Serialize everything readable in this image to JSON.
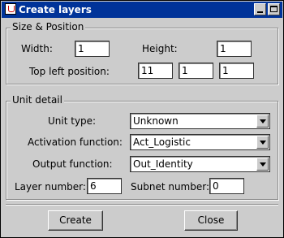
{
  "window": {
    "title": "Create layers"
  },
  "size_position": {
    "legend": "Size & Position",
    "width_label": "Width:",
    "width_value": "1",
    "height_label": "Height:",
    "height_value": "1",
    "topleft_label": "Top left position:",
    "topleft_values": [
      "11",
      "1",
      "1"
    ]
  },
  "unit_detail": {
    "legend": "Unit detail",
    "unit_type_label": "Unit type:",
    "unit_type_value": "Unknown",
    "activation_label": "Activation function:",
    "activation_value": "Act_Logistic",
    "output_label": "Output function:",
    "output_value": "Out_Identity",
    "layer_number_label": "Layer number:",
    "layer_number_value": "6",
    "subnet_number_label": "Subnet number:",
    "subnet_number_value": "0"
  },
  "buttons": {
    "create": "Create",
    "close": "Close"
  },
  "icons": {
    "app": "java-cup-icon",
    "minimize": "minimize-icon",
    "maximize": "maximize-icon"
  }
}
